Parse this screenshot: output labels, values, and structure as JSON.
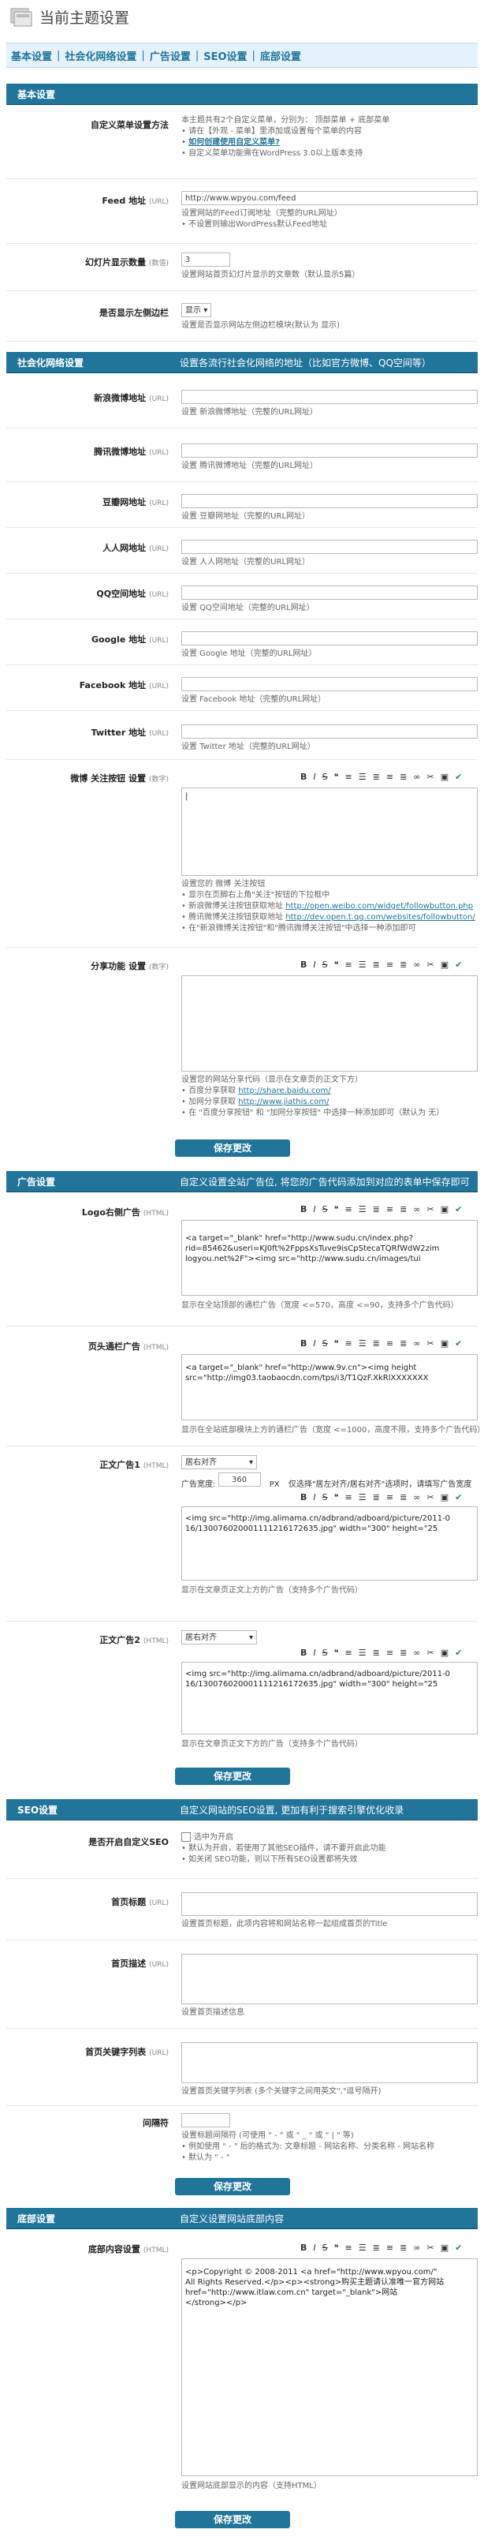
{
  "page_title": "当前主题设置",
  "nav": [
    "基本设置",
    "社会化网络设置",
    "广告设置",
    "SEO设置",
    "底部设置"
  ],
  "basic": {
    "section_title": "基本设置",
    "menu": {
      "label": "自定义菜单设置方法",
      "line1": "本主题共有2个自定义菜单，分别为： 顶部菜单 + 底部菜单",
      "line2": "请在【外观 - 菜单】里添加或设置每个菜单的内容",
      "line3": "如何创建使用自定义菜单?",
      "line4": "自定义菜单功能需在WordPress 3.0以上版本支持"
    },
    "feed": {
      "label": "Feed 地址",
      "sub": "(URL)",
      "value": "http://www.wpyou.com/feed",
      "note1": "设置网站的Feed订阅地址（完整的URL网址）",
      "note2": "不设置则输出WordPress默认Feed地址"
    },
    "slides": {
      "label": "幻灯片显示数量",
      "sub": "(数值)",
      "value": "3",
      "note": "设置网站首页幻灯片显示的文章数（默认显示5篇）"
    },
    "sidebar": {
      "label": "是否显示左侧边栏",
      "value": "显示",
      "note": "设置是否显示网站左侧边栏模块(默认为 显示)"
    }
  },
  "social": {
    "section_title": "社会化网络设置",
    "section_desc": "设置各流行社会化网络的地址（比如官方微博、QQ空间等）",
    "rows": [
      {
        "label": "新浪微博地址",
        "sub": "(URL)",
        "note": "设置 新浪微博地址（完整的URL网址）"
      },
      {
        "label": "腾讯微博地址",
        "sub": "(URL)",
        "note": "设置 腾讯微博地址（完整的URL网址）"
      },
      {
        "label": "豆瓣网地址",
        "sub": "(URL)",
        "note": "设置 豆瓣网地址（完整的URL网址）"
      },
      {
        "label": "人人网地址",
        "sub": "(URL)",
        "note": "设置 人人网地址（完整的URL网址）"
      },
      {
        "label": "QQ空间地址",
        "sub": "(URL)",
        "note": "设置 QQ空间地址（完整的URL网址）"
      },
      {
        "label": "Google 地址",
        "sub": "(URL)",
        "note": "设置 Google 地址（完整的URL网址）"
      },
      {
        "label": "Facebook 地址",
        "sub": "(URL)",
        "note": "设置 Facebook 地址（完整的URL网址）"
      },
      {
        "label": "Twitter 地址",
        "sub": "(URL)",
        "note": "设置 Twitter 地址（完整的URL网址）"
      }
    ],
    "weibo_follow": {
      "label": "微博 关注按钮 设置",
      "sub": "(数字)",
      "note1": "设置您的 微博 关注按钮",
      "note2": "显示在页脚右上角\"关注\"按钮的下拉框中",
      "note3": "新浪微博关注按钮获取地址 ",
      "link3": "http://open.weibo.com/widget/followbutton.php",
      "note4": "腾讯微博关注按钮获取地址 ",
      "link4": "http://dev.open.t.qq.com/websites/followbutton/",
      "note5": "在\"新浪微博关注按钮\"和\"腾讯微博关注按钮\"中选择一种添加即可"
    },
    "share": {
      "label": "分享功能 设置",
      "sub": "(数字)",
      "note1": "设置您的网站分享代码（显示在文章页的正文下方）",
      "note2": "百度分享获取 ",
      "link2": "http://share.baidu.com/",
      "note3": "加网分享获取 ",
      "link3": "http://www.jiathis.com/",
      "note4": "在 \"百度分享按钮\" 和 \"加网分享按钮\" 中选择一种添加即可（默认为 无）"
    },
    "save": "保存更改"
  },
  "ads": {
    "section_title": "广告设置",
    "section_desc": "自定义设置全站广告位, 将您的广告代码添加到对应的表单中保存即可",
    "logo_ad": {
      "label": "Logo右侧广告",
      "sub": "(HTML)",
      "code": "<a target=\"_blank\" href=\"http://www.sudu.cn/index.php?\nrid=85462&useri=KJ0ft%2FppsXsTuve9isCpStecaTQRfWdW2zim\nlogyou.net%2F\"><img src=\"http://www.sudu.cn/images/tui",
      "note": "显示在全站顶部的通栏广告（宽度 <=570，高度 <=90，支持多个广告代码）"
    },
    "footer_ad": {
      "label": "页头通栏广告",
      "sub": "(HTML)",
      "code": "<a target=\"_blank\" href=\"http://www.9v.cn\"><img height\nsrc=\"http://img03.taobaocdn.com/tps/i3/T1QzF.XkRlXXXXXXX",
      "note": "显示在全站底部模块上方的通栏广告（宽度 <=1000，高度不限，支持多个广告代码）"
    },
    "article_ad1": {
      "label": "正文广告1",
      "sub": "(HTML)",
      "align": "居右对齐",
      "width_label": "广告宽度:",
      "width": "360",
      "width_unit": "PX",
      "width_note": "仅选择\"居左对齐/居右对齐\"选项时，请填写广告宽度",
      "code": "<img src=\"http://img.alimama.cn/adbrand/adboard/picture/2011-0\n16/130076020001111216172635.jpg\" width=\"300\" height=\"25",
      "note": "显示在文章页正文上方的广告（支持多个广告代码）"
    },
    "article_ad2": {
      "label": "正文广告2",
      "sub": "(HTML)",
      "align": "居右对齐",
      "code": "<img src=\"http://img.alimama.cn/adbrand/adboard/picture/2011-0\n16/130076020001111216172635.jpg\" width=\"300\" height=\"25",
      "note": "显示在文章页正文下方的广告（支持多个广告代码）"
    },
    "save": "保存更改"
  },
  "seo": {
    "section_title": "SEO设置",
    "section_desc": "自定义网站的SEO设置, 更加有利于搜索引擎优化收录",
    "enable": {
      "label": "是否开启自定义SEO",
      "checkbox": "选中为开启",
      "note1": "默认为开启，若使用了其他SEO插件，请不要开启此功能",
      "note2": "如关闭 SEO功能，则以下所有SEO设置都将失效"
    },
    "home_title": {
      "label": "首页标题",
      "sub": "(URL)",
      "note": "设置首页标题，此项内容将和网站名称一起组成首页的Title"
    },
    "home_desc": {
      "label": "首页描述",
      "sub": "(URL)",
      "note": "设置首页描述信息"
    },
    "home_keywords": {
      "label": "首页关键字列表",
      "sub": "(URL)",
      "note": "设置首页关键字列表 (多个关键字之间用英文\",\"逗号隔开)"
    },
    "separator": {
      "label": "间隔符",
      "note1": "设置标题间隔符 (可使用 \" - \" 或 \" _ \" 或 \" | \" 等)",
      "note2": "例如使用 \" - \" 后的格式为: 文章标题 - 网站名称、分类名称 - 网站名称",
      "note3": "默认为 \" - \""
    },
    "save": "保存更改"
  },
  "footer": {
    "section_title": "底部设置",
    "section_desc": "自定义设置网站底部内容",
    "content": {
      "label": "底部内容设置",
      "sub": "(HTML)",
      "code": "<p>Copyright © 2008-2011 <a href=\"http://www.wpyou.com/\"\nAll Rights Reserved.</p><p><strong>购买主题请认准唯一官方网站\nhref=\"http://www.itlaw.com.cn\" target=\"_blank\">网站\n</strong></p>",
      "note": "设置网站底部显示的内容（支持HTML）"
    },
    "save": "保存更改"
  },
  "colors": {
    "accent": "#21759b",
    "nav_bg": "#e4f2fd",
    "tool_green": "#2c8a3d"
  },
  "editor_toolbar": {
    "bold": "B",
    "italic": "I",
    "strike": "S"
  }
}
